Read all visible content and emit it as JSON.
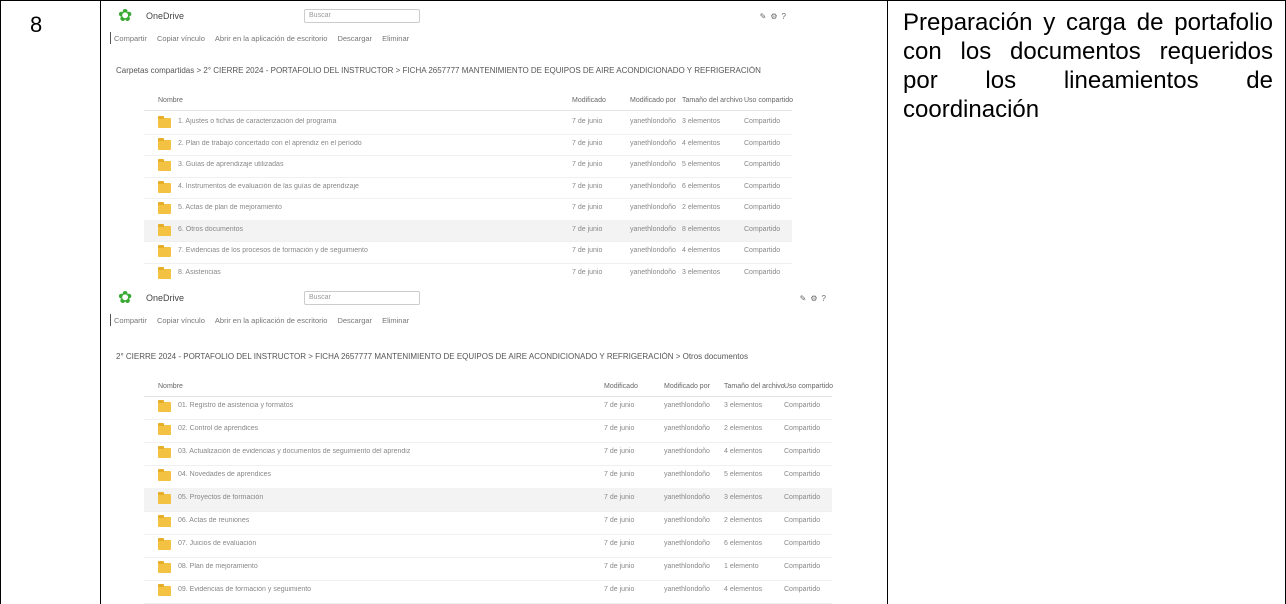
{
  "row_number": "8",
  "description": "Preparación y carga de portafolio con los documentos requeridos por los lineamientos de coordinación",
  "screenshots": [
    {
      "app_name": "OneDrive",
      "search_placeholder": "Buscar",
      "toolbar": [
        "Compartir",
        "Copiar vínculo",
        "Abrir en la aplicación de escritorio",
        "Descargar",
        "Eliminar"
      ],
      "breadcrumb": "Carpetas compartidas  >  2° CIERRE 2024 - PORTAFOLIO DEL INSTRUCTOR  >  FICHA 2657777 MANTENIMIENTO DE EQUIPOS DE AIRE ACONDICIONADO Y REFRIGERACIÓN",
      "columns": [
        "Nombre",
        "Modificado",
        "Modificado por",
        "Tamaño del archivo",
        "Uso compartido"
      ],
      "rows": [
        {
          "name": "1. Ajustes o fichas de caracterización del programa",
          "mod": "7 de junio",
          "by": "yanethlondoño",
          "size": "3 elementos",
          "share": "Compartido"
        },
        {
          "name": "2. Plan de trabajo concertado con el aprendiz en el período",
          "mod": "7 de junio",
          "by": "yanethlondoño",
          "size": "4 elementos",
          "share": "Compartido"
        },
        {
          "name": "3. Guías de aprendizaje utilizadas",
          "mod": "7 de junio",
          "by": "yanethlondoño",
          "size": "5 elementos",
          "share": "Compartido"
        },
        {
          "name": "4. Instrumentos de evaluación de las guías de aprendizaje",
          "mod": "7 de junio",
          "by": "yanethlondoño",
          "size": "6 elementos",
          "share": "Compartido"
        },
        {
          "name": "5. Actas de plan de mejoramiento",
          "mod": "7 de junio",
          "by": "yanethlondoño",
          "size": "2 elementos",
          "share": "Compartido"
        },
        {
          "name": "6. Otros documentos",
          "mod": "7 de junio",
          "by": "yanethlondoño",
          "size": "8 elementos",
          "share": "Compartido"
        },
        {
          "name": "7. Evidencias de los procesos de formación y de seguimiento",
          "mod": "7 de junio",
          "by": "yanethlondoño",
          "size": "4 elementos",
          "share": "Compartido"
        },
        {
          "name": "8. Asistencias",
          "mod": "7 de junio",
          "by": "yanethlondoño",
          "size": "3 elementos",
          "share": "Compartido"
        }
      ]
    },
    {
      "app_name": "OneDrive",
      "search_placeholder": "Buscar",
      "toolbar": [
        "Compartir",
        "Copiar vínculo",
        "Abrir en la aplicación de escritorio",
        "Descargar",
        "Eliminar"
      ],
      "breadcrumb": "2° CIERRE 2024 - PORTAFOLIO DEL INSTRUCTOR  >  FICHA 2657777 MANTENIMIENTO DE EQUIPOS DE AIRE ACONDICIONADO Y REFRIGERACIÓN  >  Otros documentos",
      "columns": [
        "Nombre",
        "Modificado",
        "Modificado por",
        "Tamaño del archivo",
        "Uso compartido"
      ],
      "rows": [
        {
          "name": "01. Registro de asistencia y formatos",
          "mod": "7 de junio",
          "by": "yanethlondoño",
          "size": "3 elementos",
          "share": "Compartido"
        },
        {
          "name": "02. Control de aprendices",
          "mod": "7 de junio",
          "by": "yanethlondoño",
          "size": "2 elementos",
          "share": "Compartido"
        },
        {
          "name": "03. Actualización de evidencias y documentos de seguimiento del aprendiz",
          "mod": "7 de junio",
          "by": "yanethlondoño",
          "size": "4 elementos",
          "share": "Compartido"
        },
        {
          "name": "04. Novedades de aprendices",
          "mod": "7 de junio",
          "by": "yanethlondoño",
          "size": "5 elementos",
          "share": "Compartido"
        },
        {
          "name": "05. Proyectos de formación",
          "mod": "7 de junio",
          "by": "yanethlondoño",
          "size": "3 elementos",
          "share": "Compartido"
        },
        {
          "name": "06. Actas de reuniones",
          "mod": "7 de junio",
          "by": "yanethlondoño",
          "size": "2 elementos",
          "share": "Compartido"
        },
        {
          "name": "07. Juicios de evaluación",
          "mod": "7 de junio",
          "by": "yanethlondoño",
          "size": "6 elementos",
          "share": "Compartido"
        },
        {
          "name": "08. Plan de mejoramiento",
          "mod": "7 de junio",
          "by": "yanethlondoño",
          "size": "1 elemento",
          "share": "Compartido"
        },
        {
          "name": "09. Evidencias de formación y seguimiento",
          "mod": "7 de junio",
          "by": "yanethlondoño",
          "size": "4 elementos",
          "share": "Compartido"
        }
      ]
    }
  ]
}
